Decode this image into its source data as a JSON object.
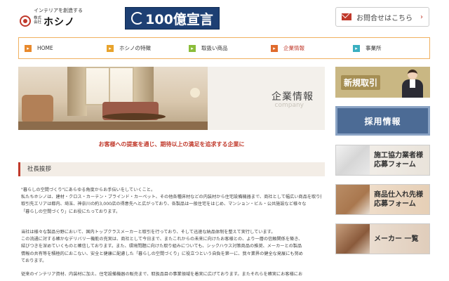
{
  "header": {
    "logo_tagline": "インテリアを創造する",
    "logo_small": "株式会社",
    "logo_name": "ホシノ",
    "banner_text": "100億宣言",
    "contact_label": "お問合せはこちら"
  },
  "nav": {
    "items": [
      {
        "label": "HOME",
        "color": "#e8892c"
      },
      {
        "label": "ホシノの特徴",
        "color": "#e8a32c"
      },
      {
        "label": "取扱い商品",
        "color": "#8bbd3a"
      },
      {
        "label": "企業情報",
        "color": "#e06b2c"
      },
      {
        "label": "事業所",
        "color": "#3aafc0"
      }
    ],
    "active_index": 3
  },
  "hero": {
    "title": "企業情報",
    "subtitle": "company"
  },
  "tagline": "お客様への提案を通じ、期待以上の満足を追求する企業に",
  "section": {
    "title": "社長挨拶"
  },
  "body": {
    "p1": [
      "\"暮らしの空間づくり\"にあらゆる角度からお手伝いをしていくこと。",
      "私たちホシノは、建材・クロス・カーテン・ブラインド・カーペット、その他各種床材などの内装材から住宅設備機器まで、商社として幅広い商品を取り扱っています。",
      "取引先エリアは都内、埼玉、神奈川の約3,000店の得意先へと広がっており、各製品は一般住宅をはじめ、マンション・ビル・公共施設など様々な",
      "「暮らしの空間づくり」にお役にたっております。"
    ],
    "p2": [
      "当社は様々な製品分野において、国内トップクラスメーカーと取引を行っており、そして迅速な納品体制を整えて実行しています。",
      "この流通に対する確かなデリバリー機能の充実は、商社として今日まで、またこれからの未来に向けたお客様との、より一層の信頼関係を築き、",
      "結びつきを深めていくものと確信しております。また、環境問題に向けた取り組みについても、シックハウス対策商品の推奨、メーカーとの製品",
      "情報の共有等を積極的におこない、安全と健康に配慮した「暮らしの空間づくり」に役立つという自負を第一に、我々業界の健全な発展にも努め",
      "ております。"
    ],
    "p3": [
      "従来のインテリア資材、内装材に加え、住宅設備機器の販売まで、取扱品目の事業領域を着実に広げております。またそれらを確実にお客様にお"
    ]
  },
  "sidebar": {
    "new_business": "新規取引",
    "recruit": "採用情報",
    "partner_form": [
      "施工協力業者様",
      "応募フォーム"
    ],
    "supplier_form": [
      "商品仕入れ先様",
      "応募フォーム"
    ],
    "makers": "メーカー 一覧"
  }
}
